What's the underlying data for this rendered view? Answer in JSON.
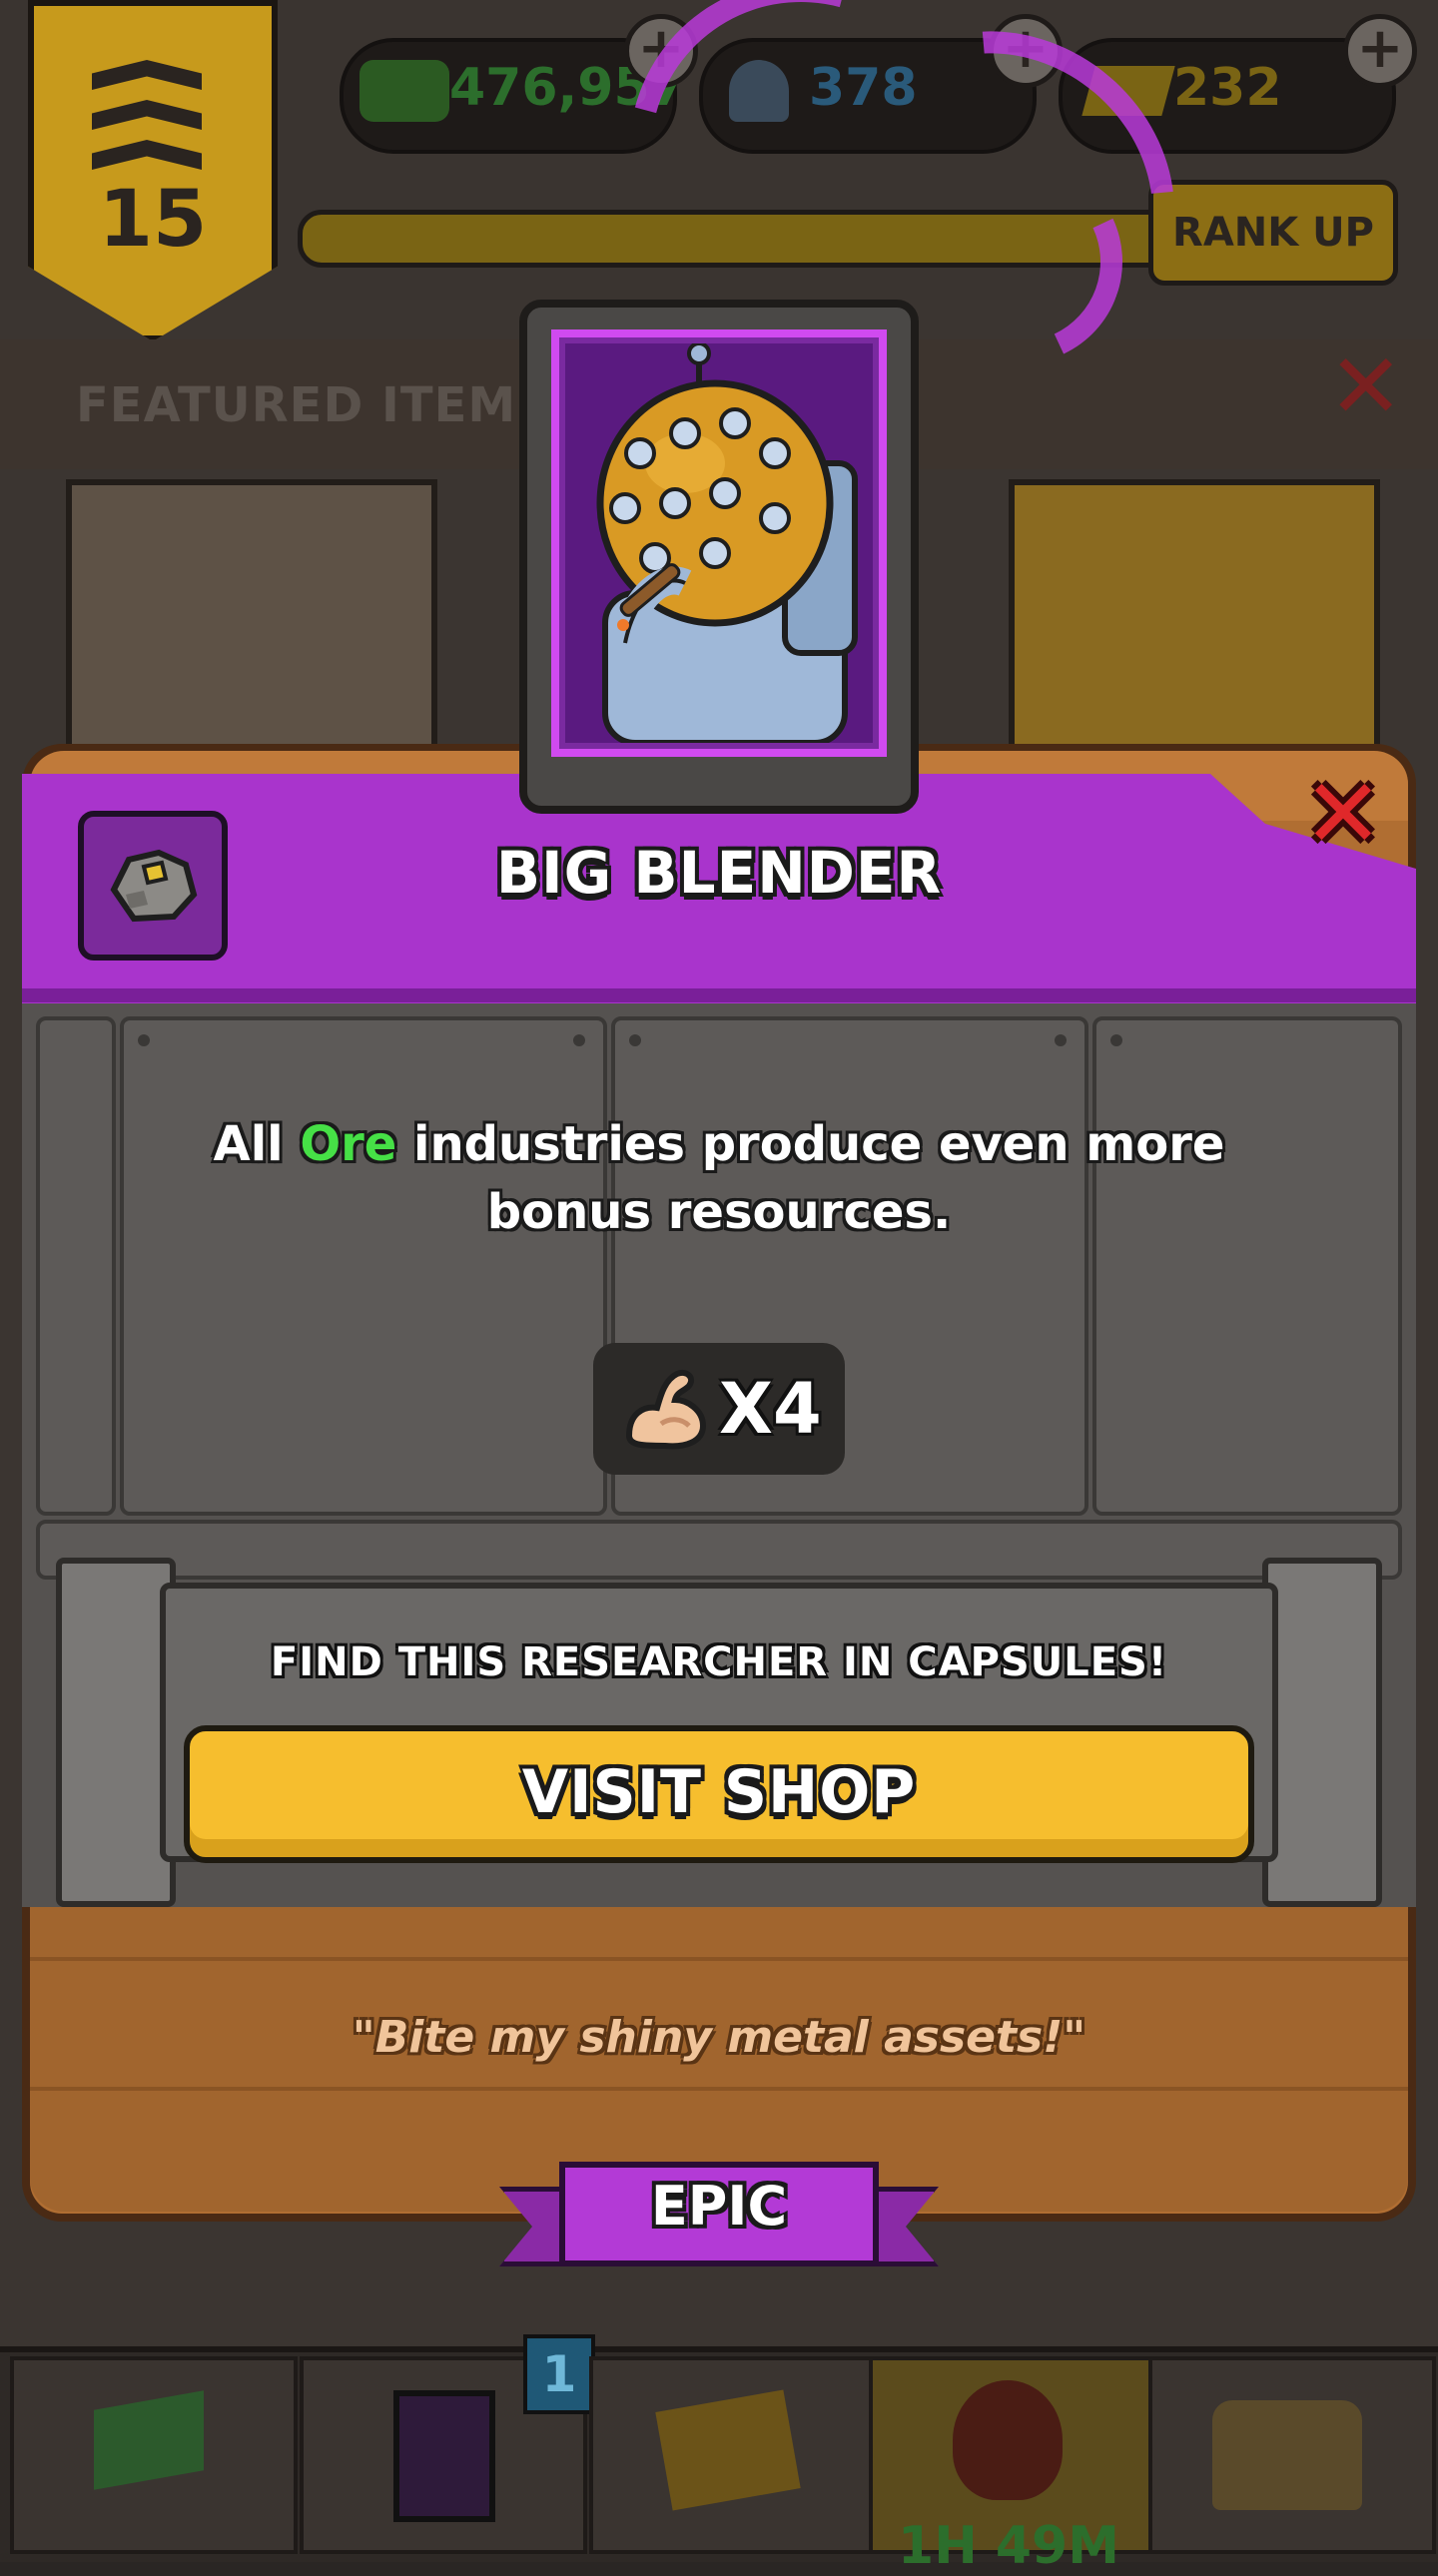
{
  "top_bar": {
    "rank_level": "15",
    "cash": "476,957",
    "science": "378",
    "gold": "232",
    "rank_up_label": "RANK UP"
  },
  "featured": {
    "title": "FEATURED ITEMS"
  },
  "bottom_nav": {
    "cards_badge": "1",
    "timer": "1H 49M"
  },
  "researcher": {
    "name": "BIG BLENDER",
    "description_prefix": "All ",
    "description_highlight": "Ore",
    "description_suffix": " industries produce even more bonus resources.",
    "multiplier": "X4",
    "find_caption": "FIND THIS RESEARCHER IN CAPSULES!",
    "visit_shop_label": "VISIT SHOP",
    "quote": "\"Bite my shiny metal assets!\"",
    "rarity": "EPIC",
    "industry_icon": "ore-rock-icon",
    "multiplier_icon": "flexed-bicep-icon"
  },
  "colors": {
    "rarity_purple": "#a934cc",
    "highlight_green": "#46e046",
    "button_yellow": "#f6be2e",
    "close_red": "#e0282a"
  }
}
